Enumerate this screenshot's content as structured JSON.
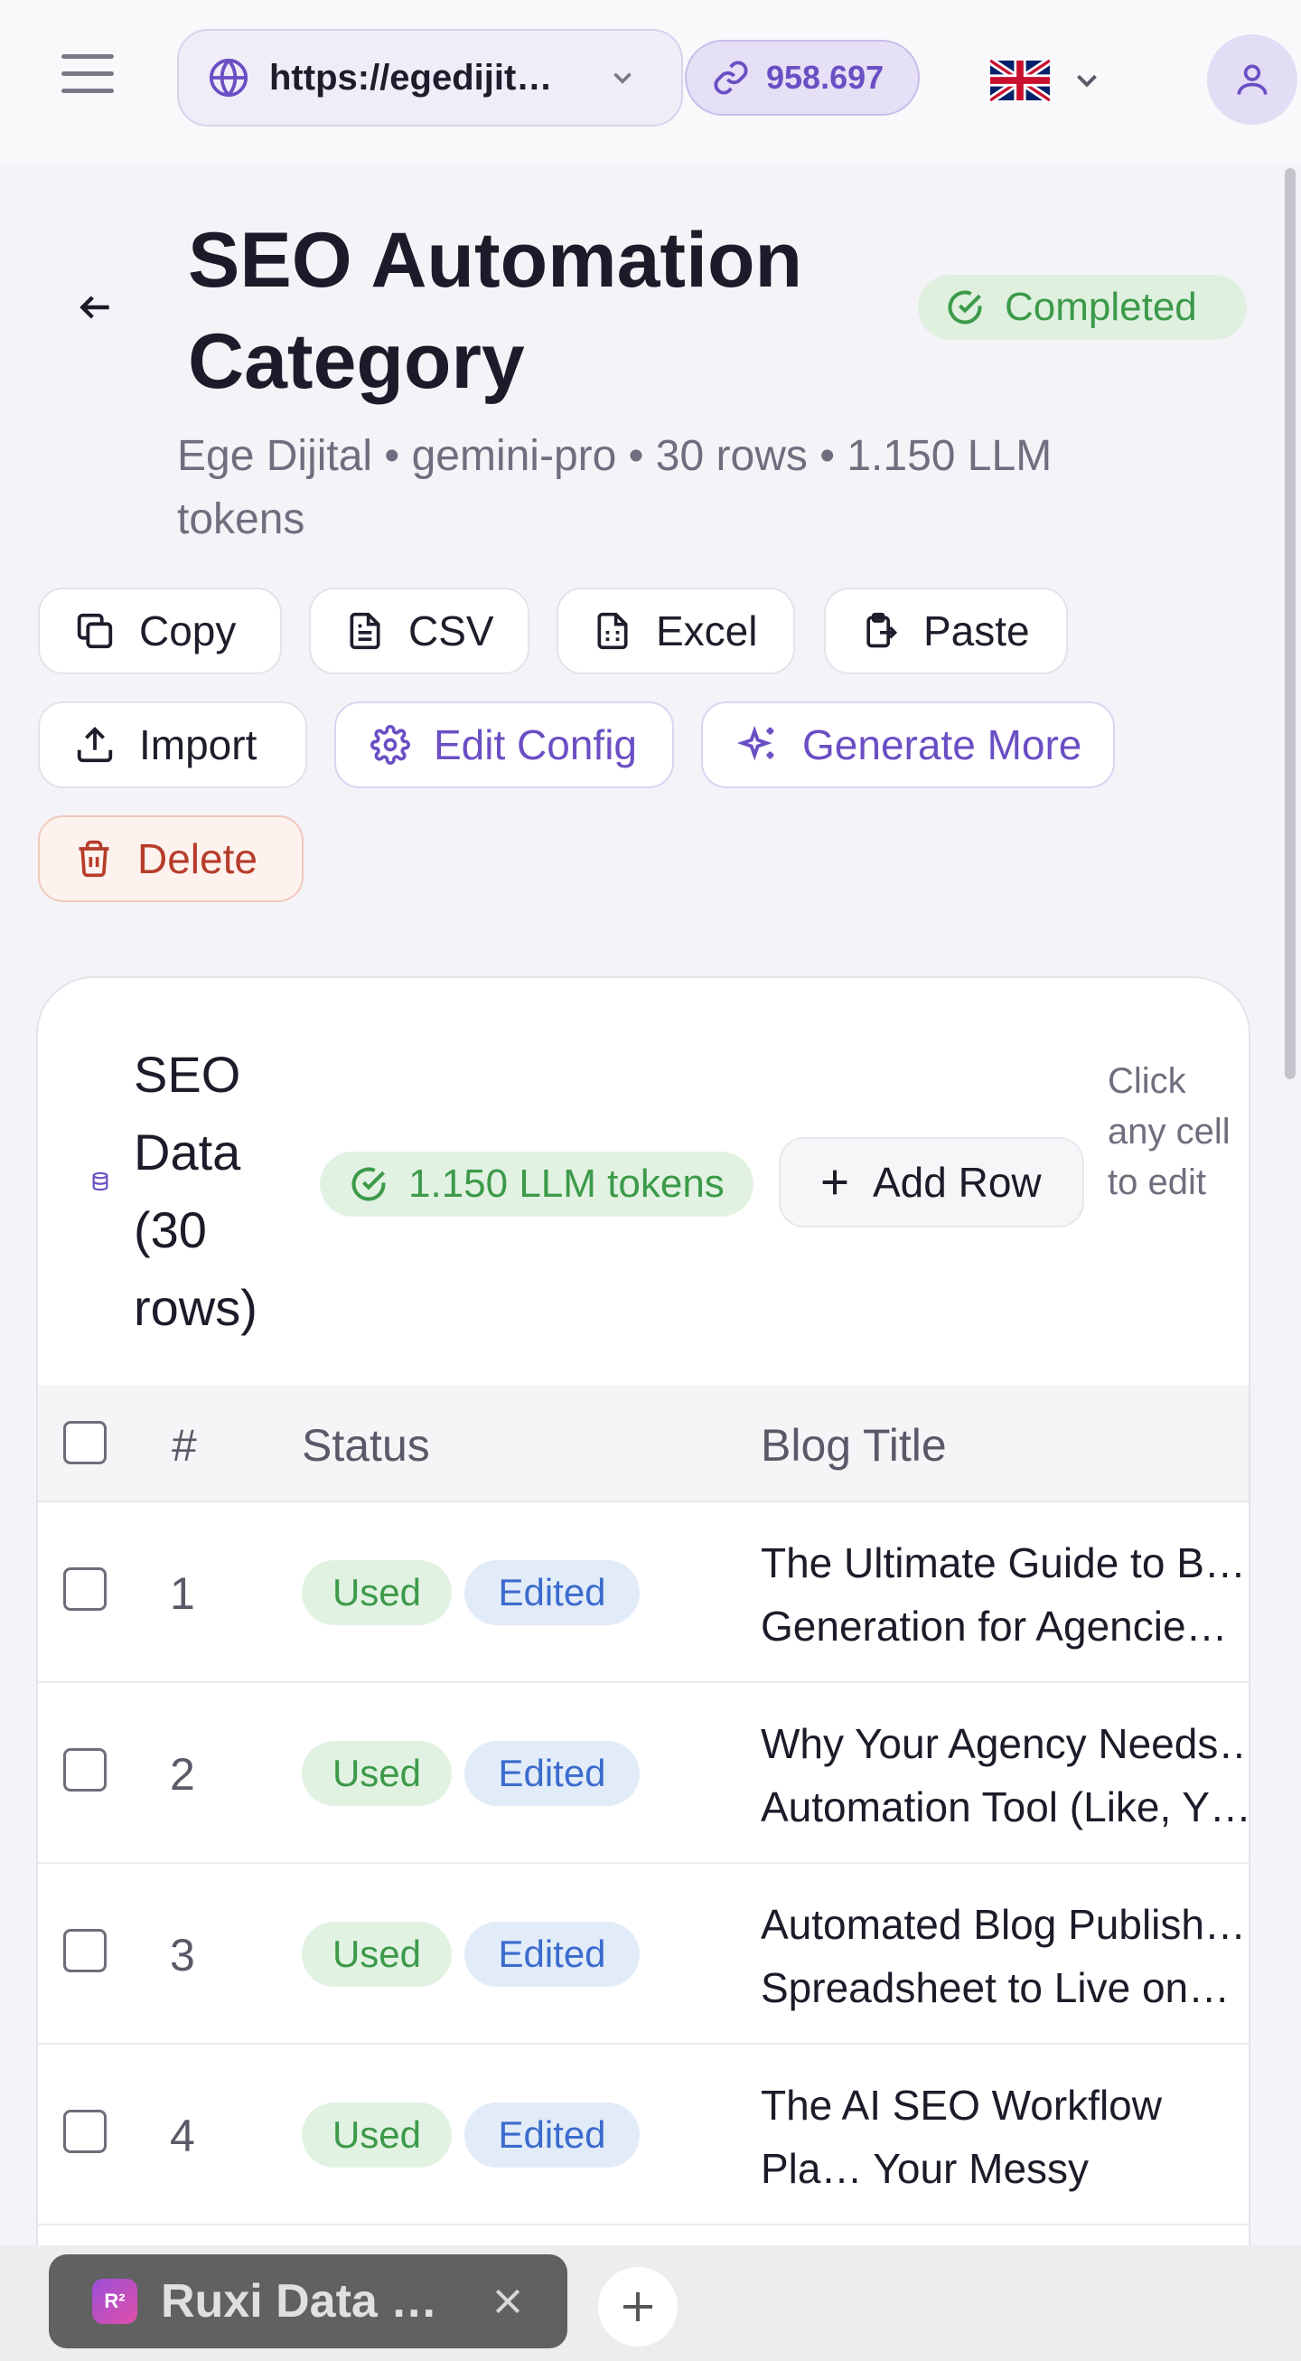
{
  "browser": {
    "url": "https://egedijit…",
    "link_count": "958.697",
    "language_flag": "uk-flag-icon"
  },
  "header": {
    "title": "SEO Automation Category",
    "status": "Completed",
    "meta": "Ege Dijital • gemini-pro • 30 rows • 1.150 LLM tokens"
  },
  "actions": {
    "copy": "Copy",
    "csv": "CSV",
    "excel": "Excel",
    "paste": "Paste",
    "import": "Import",
    "edit_config": "Edit Config",
    "generate_more": "Generate More",
    "delete": "Delete"
  },
  "card": {
    "title": "SEO Data (30 rows)",
    "tokens": "1.150 LLM tokens",
    "add_row": "Add Row",
    "hint": "Click any cell to edit"
  },
  "table": {
    "columns": {
      "number": "#",
      "status": "Status",
      "title": "Blog Title"
    },
    "rows": [
      {
        "num": "1",
        "used": "Used",
        "edited": "Edited",
        "title": "The Ultimate Guide to B… Generation for Agencie…"
      },
      {
        "num": "2",
        "used": "Used",
        "edited": "Edited",
        "title": "Why Your Agency Needs… Automation Tool (Like, Y…"
      },
      {
        "num": "3",
        "used": "Used",
        "edited": "Edited",
        "title": "Automated Blog Publish… Spreadsheet to Live on…"
      },
      {
        "num": "4",
        "used": "Used",
        "edited": "Edited",
        "title": "The AI SEO Workflow Pla… Your Messy Spreadshee…"
      }
    ]
  },
  "tabbar": {
    "tab_title": "Ruxi Data …",
    "logo_text": "R²"
  },
  "colors": {
    "accent": "#6a4fc4",
    "success": "#3c9a4a",
    "danger": "#b73c2a",
    "info": "#3b6bcd"
  }
}
